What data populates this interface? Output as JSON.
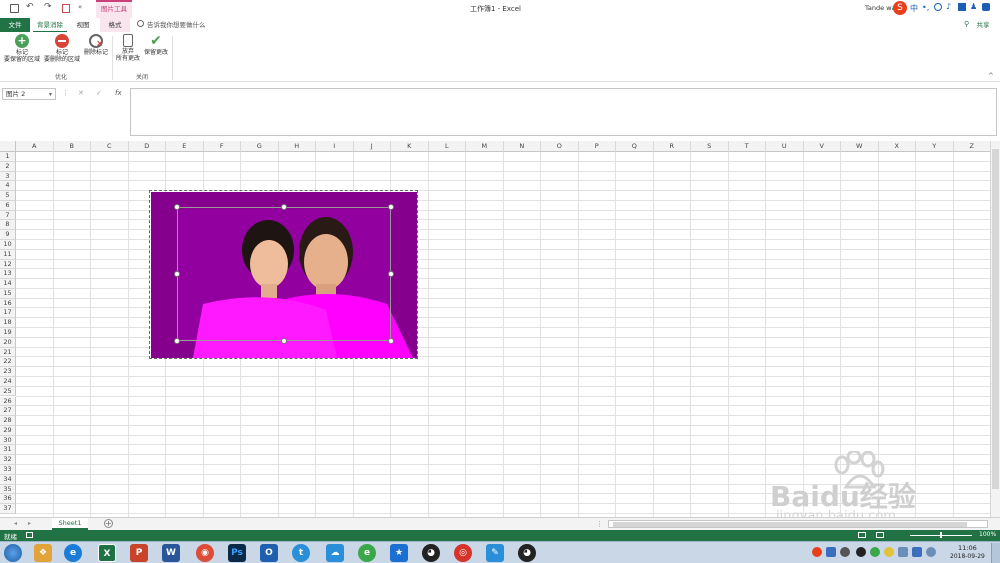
{
  "titlebar": {
    "title": "工作簿1 - Excel",
    "picture_tools": "图片工具",
    "user": "Tande wa"
  },
  "ribbon_tabs": {
    "file": "文件",
    "bg_removal": "背景消除",
    "view": "视图",
    "format": "格式",
    "tell_me": "告诉我你想要做什么",
    "share": "共享"
  },
  "ribbon": {
    "mark_keep": "标记\n要保留的区域",
    "mark_keep_l1": "标记",
    "mark_keep_l2": "要保留的区域",
    "mark_remove_l1": "标记",
    "mark_remove_l2": "要删除的区域",
    "delete_mark": "删除标记",
    "discard_l1": "放弃",
    "discard_l2": "所有更改",
    "keep_changes": "保留更改",
    "group_refine": "优化",
    "group_close": "关闭"
  },
  "formula_bar": {
    "name_box": "图片 2",
    "fx": "fx"
  },
  "columns": [
    "A",
    "B",
    "C",
    "D",
    "E",
    "F",
    "G",
    "H",
    "I",
    "J",
    "K",
    "L",
    "M",
    "N",
    "O",
    "P",
    "Q",
    "R",
    "S",
    "T",
    "U",
    "V",
    "W",
    "X",
    "Y",
    "Z"
  ],
  "rows": [
    "1",
    "2",
    "3",
    "4",
    "5",
    "6",
    "7",
    "8",
    "9",
    "10",
    "11",
    "12",
    "13",
    "14",
    "15",
    "16",
    "17",
    "18",
    "19",
    "20",
    "21",
    "22",
    "23",
    "24",
    "25",
    "26",
    "27",
    "28",
    "29",
    "30",
    "31",
    "32",
    "33",
    "34",
    "35",
    "36",
    "37"
  ],
  "sheet_tab": "Sheet1",
  "status": {
    "ready": "就绪",
    "zoom": "100%"
  },
  "taskbar": {
    "time": "11:06",
    "date": "2018-09-29"
  },
  "watermark": {
    "brand": "Baidu经验",
    "url": "jingyan.baidu.com"
  },
  "colors": {
    "excel_green": "#217346",
    "picture_tools_pink": "#c9407a",
    "photo_bg": "#8a0090",
    "shirt_magenta": "#ff00ff"
  }
}
